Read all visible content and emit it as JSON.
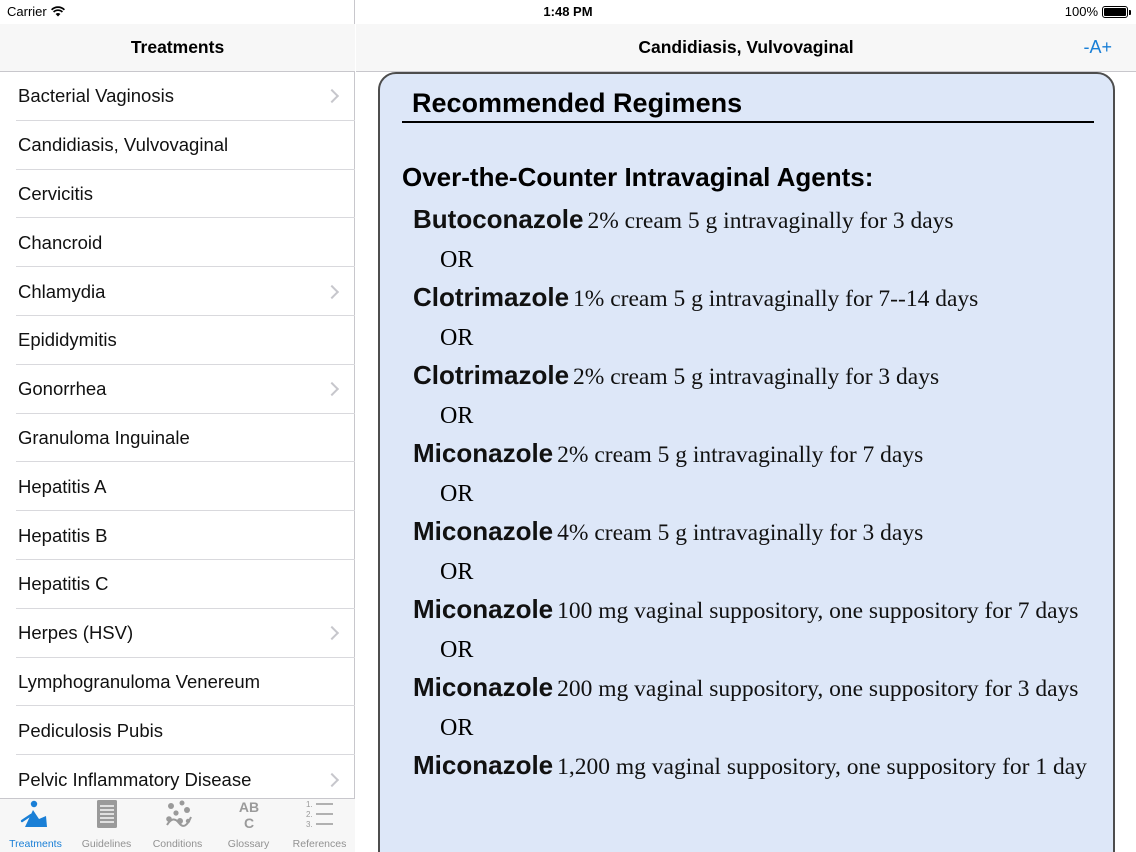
{
  "status_bar": {
    "carrier": "Carrier",
    "time": "1:48 PM",
    "battery": "100%"
  },
  "left_pane": {
    "title": "Treatments",
    "items": [
      {
        "label": "Bacterial Vaginosis",
        "chevron": true
      },
      {
        "label": "Candidiasis, Vulvovaginal",
        "chevron": false
      },
      {
        "label": "Cervicitis",
        "chevron": false
      },
      {
        "label": "Chancroid",
        "chevron": false
      },
      {
        "label": "Chlamydia",
        "chevron": true
      },
      {
        "label": "Epididymitis",
        "chevron": false
      },
      {
        "label": "Gonorrhea",
        "chevron": true
      },
      {
        "label": "Granuloma Inguinale",
        "chevron": false
      },
      {
        "label": "Hepatitis A",
        "chevron": false
      },
      {
        "label": "Hepatitis B",
        "chevron": false
      },
      {
        "label": "Hepatitis C",
        "chevron": false
      },
      {
        "label": "Herpes (HSV)",
        "chevron": true
      },
      {
        "label": "Lymphogranuloma Venereum",
        "chevron": false
      },
      {
        "label": "Pediculosis Pubis",
        "chevron": false
      },
      {
        "label": "Pelvic Inflammatory Disease",
        "chevron": true
      }
    ]
  },
  "tabs": [
    {
      "label": "Treatments",
      "icon": "treatments-icon",
      "active": true
    },
    {
      "label": "Guidelines",
      "icon": "guidelines-icon",
      "active": false
    },
    {
      "label": "Conditions",
      "icon": "conditions-icon",
      "active": false
    },
    {
      "label": "Glossary",
      "icon": "glossary-icon",
      "active": false
    },
    {
      "label": "References",
      "icon": "references-icon",
      "active": false
    }
  ],
  "right_pane": {
    "title": "Candidiasis, Vulvovaginal",
    "font_button": "-A+",
    "heading": "Recommended Regimens",
    "subheading": "Over-the-Counter Intravaginal Agents:",
    "separator": "OR",
    "regimens": [
      {
        "drug": "Butoconazole",
        "detail": "2% cream 5 g intravaginally for 3 days"
      },
      {
        "drug": "Clotrimazole",
        "detail": "1% cream 5 g intravaginally for 7--14 days"
      },
      {
        "drug": "Clotrimazole",
        "detail": "2% cream 5 g intravaginally for 3 days"
      },
      {
        "drug": "Miconazole",
        "detail": "2% cream 5 g intravaginally for 7 days"
      },
      {
        "drug": "Miconazole",
        "detail": "4% cream 5 g intravaginally for 3 days"
      },
      {
        "drug": "Miconazole",
        "detail": "100 mg vaginal suppository, one suppository for 7 days"
      },
      {
        "drug": "Miconazole",
        "detail": "200 mg vaginal suppository, one suppository for 3 days"
      },
      {
        "drug": "Miconazole",
        "detail": "1,200 mg vaginal suppository, one suppository for 1 day"
      }
    ]
  },
  "colors": {
    "accent": "#1a7fd6",
    "card_background": "#dde7f8",
    "card_border": "#4d4d4d",
    "inactive_tab": "#929292"
  }
}
